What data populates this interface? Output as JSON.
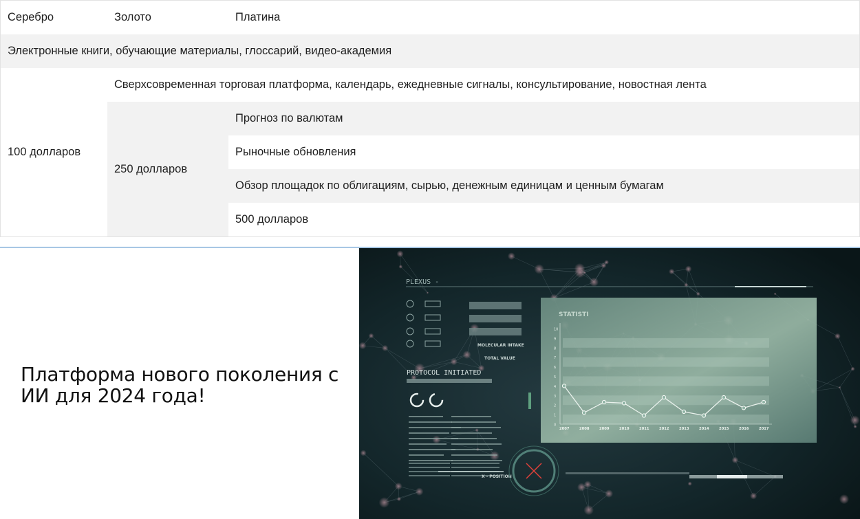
{
  "table": {
    "headers": {
      "silver": "Серебро",
      "gold": "Золото",
      "platinum": "Платина"
    },
    "all_plans_features": "Электронные книги, обучающие материалы, глоссарий, видео-академия",
    "silver_price": "100 долларов",
    "gold_plus_features": "Сверхсовременная торговая платформа, календарь, ежедневные сигналы, консультирование, новостная лента",
    "gold_price": "250 долларов",
    "platinum_features": [
      "Прогноз по валютам",
      "Рыночные обновления",
      "Обзор площадок по облигациям, сырью, денежным единицам и ценным бумагам"
    ],
    "platinum_price": "500 долларов"
  },
  "promo": {
    "headline": "Платформа нового поколения с ИИ для 2024 года!"
  },
  "hero_image": {
    "brand": "PLEXUS -",
    "protocol": "PROTOCOL INITIATED",
    "molecular": "MOLECULAR INTAKE",
    "total": "TOTAL VALUE",
    "position": "X - POSITION",
    "chart_heading": "STATISTI",
    "y_ticks": [
      "10",
      "9",
      "8",
      "7",
      "6",
      "5",
      "4",
      "3",
      "2",
      "1",
      "0"
    ],
    "x_ticks": [
      "2007",
      "2008",
      "2009",
      "2010",
      "2011",
      "2012",
      "2013",
      "2014",
      "2015",
      "2016",
      "2017"
    ],
    "line_values": [
      4,
      1.2,
      2.3,
      2.2,
      0.9,
      2.8,
      1.3,
      0.9,
      2.8,
      1.7,
      2.3
    ],
    "colors": {
      "bg": "#0f2327",
      "panel": "#8fb3a4",
      "line": "#e9f1ec",
      "accent": "#e0413a"
    }
  }
}
